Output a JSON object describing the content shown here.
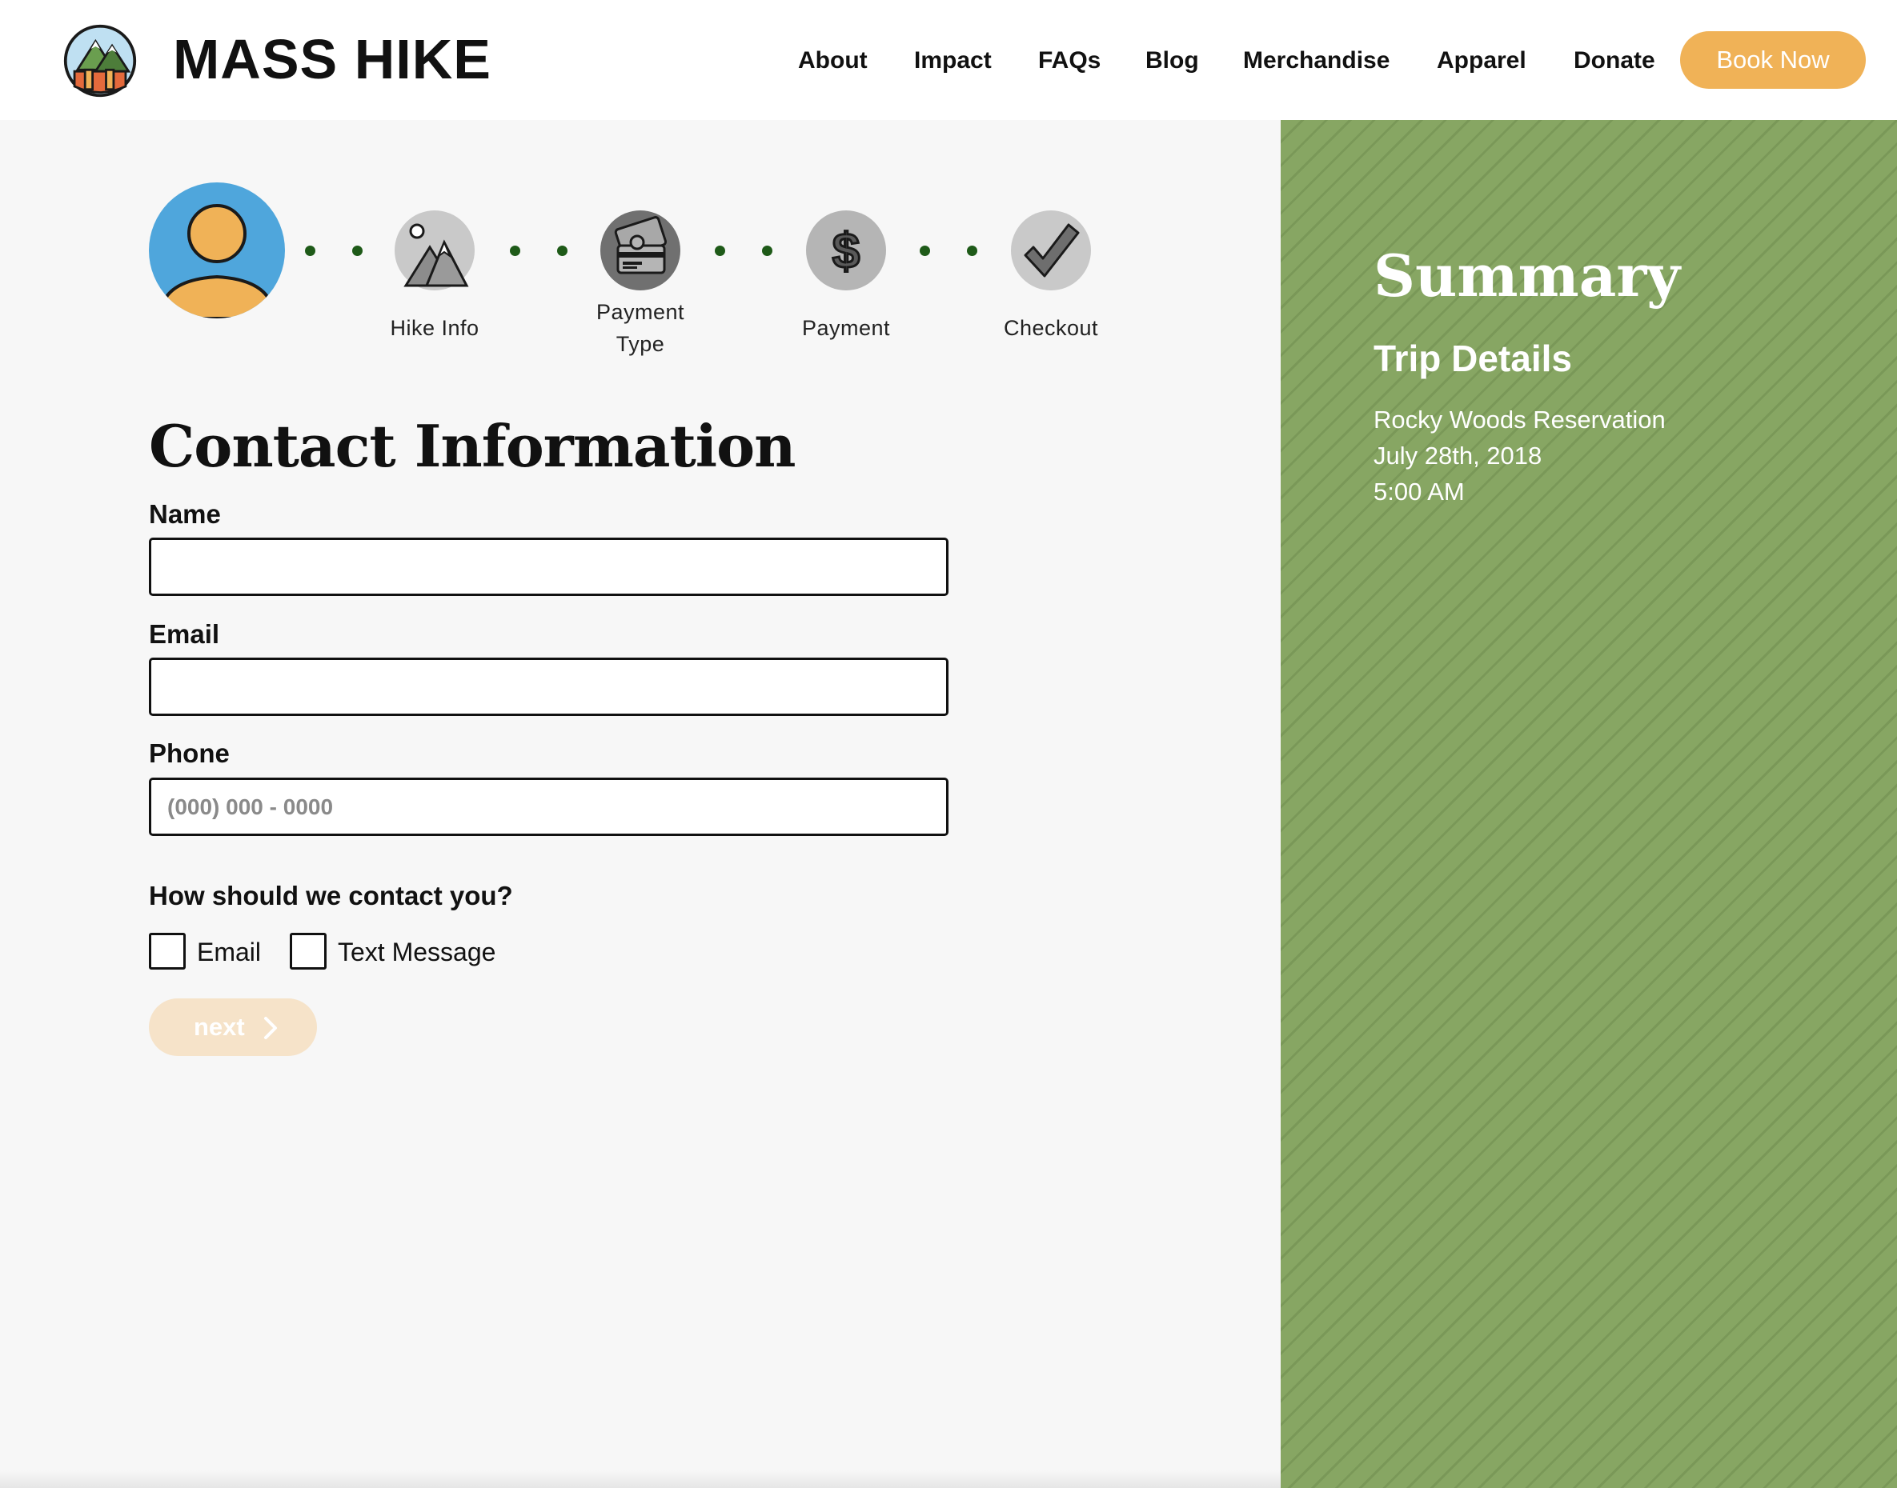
{
  "header": {
    "brand": "MASS HIKE",
    "logo_icon": "mountain-badge-icon",
    "nav": [
      "About",
      "Impact",
      "FAQs",
      "Blog",
      "Merchandise",
      "Apparel",
      "Donate"
    ],
    "book_now": "Book Now"
  },
  "progress": {
    "steps": [
      {
        "label": "Hike Info",
        "icon": "mountain-icon"
      },
      {
        "label": "Payment",
        "label2": "Type",
        "icon": "credit-card-icon"
      },
      {
        "label": "Payment",
        "icon": "dollar-icon"
      },
      {
        "label": "Checkout",
        "icon": "checkmark-icon"
      }
    ],
    "current_step_icon": "user-avatar-icon"
  },
  "form": {
    "title": "Contact Information",
    "name_label": "Name",
    "name_value": "",
    "email_label": "Email",
    "email_value": "",
    "phone_label": "Phone",
    "phone_placeholder": "(000) 000 - 0000",
    "contact_question": "How should we contact you?",
    "options": [
      {
        "label": "Email",
        "checked": false
      },
      {
        "label": "Text Message",
        "checked": false
      }
    ],
    "next_label": "next"
  },
  "summary": {
    "title": "Summary",
    "trip_title": "Trip Details",
    "location": "Rocky Woods Reservation",
    "date": "July 28th, 2018",
    "time": "5:00 AM"
  },
  "colors": {
    "accent": "#f0b257",
    "sidebar": "#87a663",
    "avatar_bg": "#4fa6dc",
    "dot": "#1e5a18"
  }
}
